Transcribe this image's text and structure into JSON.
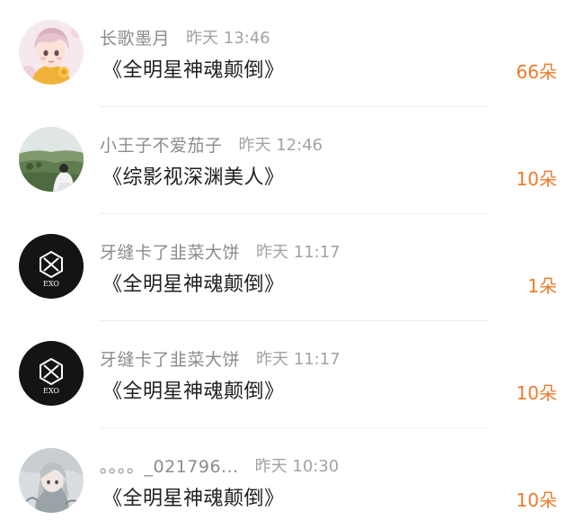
{
  "entries": [
    {
      "name": "长歌墨月",
      "time": "昨天 13:46",
      "book": "《全明星神魂颠倒》",
      "count": "66朵",
      "avatar": "anime-character-avatar"
    },
    {
      "name": "小王子不爱茄子",
      "time": "昨天 12:46",
      "book": "《综影视深渊美人》",
      "count": "10朵",
      "avatar": "landscape-photo-avatar"
    },
    {
      "name": "牙缝卡了韭菜大饼",
      "time": "昨天 11:17",
      "book": "《全明星神魂颠倒》",
      "count": "1朵",
      "avatar": "exo-logo-avatar"
    },
    {
      "name": "牙缝卡了韭菜大饼",
      "time": "昨天 11:17",
      "book": "《全明星神魂颠倒》",
      "count": "10朵",
      "avatar": "exo-logo-avatar"
    },
    {
      "name": "。。。。_021796...",
      "time": "昨天 10:30",
      "book": "《全明星神魂颠倒》",
      "count": "10朵",
      "avatar": "anime-illustration-avatar"
    }
  ],
  "logo_text": "EXO",
  "colors": {
    "count": "#f07a2a",
    "name": "#8c8c8c",
    "time": "#a3a3a3",
    "title": "#1f1f1f",
    "exo_background": "#141414"
  }
}
